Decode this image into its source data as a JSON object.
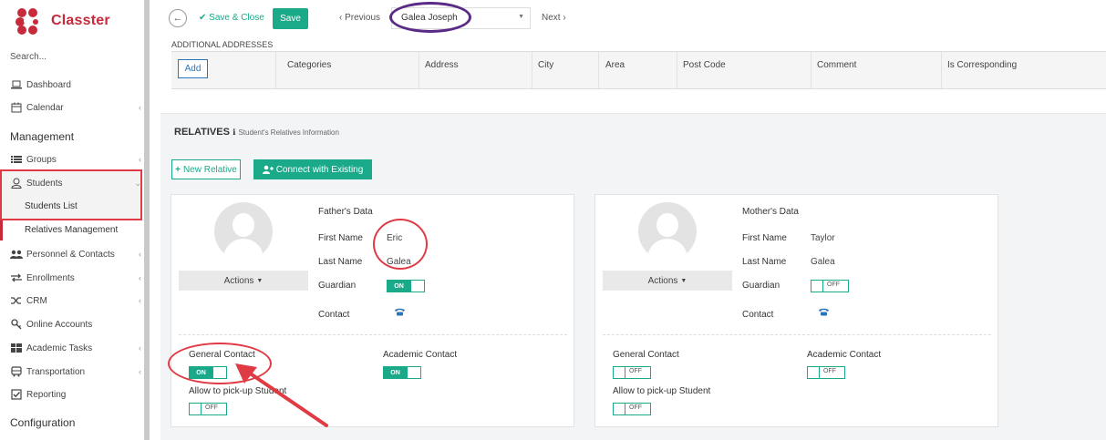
{
  "app": {
    "name": "Classter"
  },
  "colors": {
    "accent": "#1aaa8a",
    "brand": "#c62a3b",
    "highlight": "#e03a44",
    "oval": "#5b2a86"
  },
  "sidebar": {
    "search_placeholder": "Search...",
    "items": [
      {
        "label": "Dashboard",
        "icon": "laptop-icon"
      },
      {
        "label": "Calendar",
        "icon": "calendar-icon"
      }
    ],
    "section_management": "Management",
    "management_items": [
      {
        "label": "Groups",
        "icon": "list-icon"
      },
      {
        "label": "Students",
        "icon": "user-icon"
      }
    ],
    "students_sub": [
      "Students List",
      "Relatives Management"
    ],
    "more_items": [
      {
        "label": "Personnel & Contacts",
        "icon": "people-icon"
      },
      {
        "label": "Enrollments",
        "icon": "exchange-icon"
      },
      {
        "label": "CRM",
        "icon": "shuffle-icon"
      },
      {
        "label": "Online Accounts",
        "icon": "key-icon"
      },
      {
        "label": "Academic Tasks",
        "icon": "grid-icon"
      },
      {
        "label": "Transportation",
        "icon": "bus-icon"
      },
      {
        "label": "Reporting",
        "icon": "check-square-icon"
      }
    ],
    "section_configuration": "Configuration"
  },
  "toolbar": {
    "save_close": "Save & Close",
    "save": "Save",
    "previous": "Previous",
    "student": "Galea Joseph",
    "next": "Next"
  },
  "addresses": {
    "title": "ADDITIONAL ADDRESSES",
    "add": "Add",
    "columns": [
      "Categories",
      "Address",
      "City",
      "Area",
      "Post Code",
      "Comment",
      "Is Corresponding"
    ]
  },
  "relatives": {
    "title": "RELATIVES",
    "subtitle": "Student's Relatives Information",
    "new_relative": "New Relative",
    "connect": "Connect with Existing",
    "actions_label": "Actions",
    "field_labels": {
      "first_name": "First Name",
      "last_name": "Last Name",
      "guardian": "Guardian",
      "contact": "Contact"
    },
    "section_labels": {
      "general": "General Contact",
      "academic": "Academic Contact",
      "pickup": "Allow to pick-up Student"
    },
    "toggle_on": "ON",
    "toggle_off": "OFF",
    "father": {
      "title": "Father's Data",
      "first_name": "Eric",
      "last_name": "Galea",
      "guardian": "ON",
      "general_contact": "ON",
      "academic_contact": "ON",
      "pickup": "OFF"
    },
    "mother": {
      "title": "Mother's Data",
      "first_name": "Taylor",
      "last_name": "Galea",
      "guardian": "OFF",
      "general_contact": "OFF",
      "academic_contact": "OFF",
      "pickup": "OFF"
    }
  }
}
